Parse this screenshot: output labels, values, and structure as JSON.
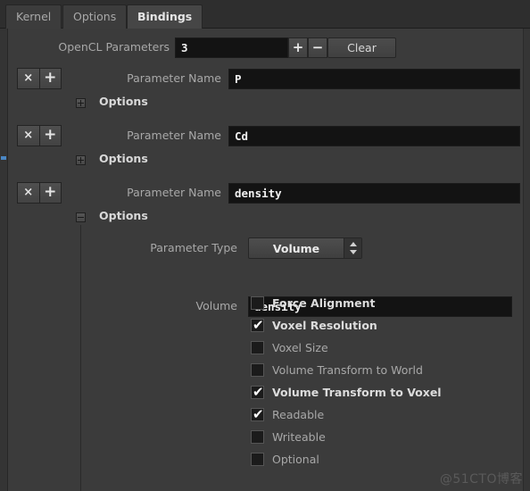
{
  "window": {
    "tabs": [
      {
        "label": "Kernel",
        "active": false
      },
      {
        "label": "Options",
        "active": false
      },
      {
        "label": "Bindings",
        "active": true
      }
    ]
  },
  "toolbar": {
    "opencl_params_label": "OpenCL Parameters",
    "opencl_params_value": "3",
    "add_label": "+",
    "remove_label": "−",
    "clear_label": "Clear"
  },
  "parameters": [
    {
      "delete_label": "×",
      "add_label": "+",
      "name_label": "Parameter Name",
      "name_value": "P",
      "options_label": "Options",
      "expanded": false
    },
    {
      "delete_label": "×",
      "add_label": "+",
      "name_label": "Parameter Name",
      "name_value": "Cd",
      "options_label": "Options",
      "expanded": false
    },
    {
      "delete_label": "×",
      "add_label": "+",
      "name_label": "Parameter Name",
      "name_value": "density",
      "options_label": "Options",
      "expanded": true
    }
  ],
  "details": {
    "parameter_type_label": "Parameter Type",
    "parameter_type_value": "Volume",
    "volume_label": "Volume",
    "volume_value": "density",
    "checkboxes": [
      {
        "label": "Force Alignment",
        "checked": false,
        "bold": true,
        "check_glyph": ""
      },
      {
        "label": "Voxel Resolution",
        "checked": true,
        "bold": true,
        "check_glyph": "✔"
      },
      {
        "label": "Voxel Size",
        "checked": false,
        "bold": false,
        "check_glyph": ""
      },
      {
        "label": "Volume Transform to World",
        "checked": false,
        "bold": false,
        "check_glyph": ""
      },
      {
        "label": "Volume Transform to Voxel",
        "checked": true,
        "bold": true,
        "check_glyph": "✔"
      },
      {
        "label": "Readable",
        "checked": true,
        "bold": false,
        "check_glyph": "✔"
      },
      {
        "label": "Writeable",
        "checked": false,
        "bold": false,
        "check_glyph": ""
      },
      {
        "label": "Optional",
        "checked": false,
        "bold": false,
        "check_glyph": ""
      }
    ]
  },
  "watermark": {
    "text": "@51CTO博客"
  },
  "colors": {
    "background": "#3b3b3b",
    "tabbar": "#2e2e2e",
    "active_tab": "#464646",
    "field_background": "#131313",
    "accent": "#4a87c4"
  }
}
